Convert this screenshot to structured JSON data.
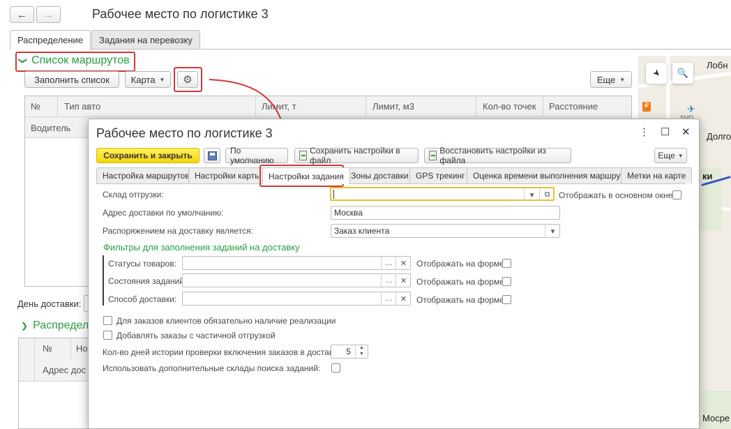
{
  "window": {
    "back_icon": "←",
    "forward_icon": "→",
    "title": "Рабочее место по логистике 3"
  },
  "main_tabs": [
    {
      "label": "Распределение",
      "active": true
    },
    {
      "label": "Задания на перевозку",
      "active": false
    }
  ],
  "routes": {
    "group_title": "Список маршрутов",
    "fill_button": "Заполнить список",
    "map_button": "Карта",
    "more_button": "Еще",
    "columns": [
      "№",
      "Тип авто",
      "Лимит, т",
      "Лимит, м3",
      "Кол-во точек",
      "Расстояние"
    ],
    "subheader": "Водитель"
  },
  "delivery_day_label": "День доставки:",
  "distribution": {
    "group_title": "Распредел",
    "columns": [
      "№",
      "Но"
    ],
    "subheader": "Адрес дос"
  },
  "map": {
    "labels": [
      "Лобн",
      "Долго",
      "ки",
      "Мосре"
    ],
    "svo_label": "SVO"
  },
  "dialog": {
    "title": "Рабочее место по логистике 3",
    "controls": [
      "⋮",
      "☐",
      "✕"
    ],
    "toolbar": {
      "save_close": "Сохранить и закрыть",
      "defaults": "По умолчанию",
      "save_file": "Сохранить настройки в файл",
      "restore_file": "Восстановить настройки из файла",
      "more": "Еще"
    },
    "tabs": [
      {
        "label": "Настройка маршрутов",
        "active": false
      },
      {
        "label": "Настройки карты",
        "active": false
      },
      {
        "label": "Настройки задания",
        "active": true
      },
      {
        "label": "Зоны доставки",
        "active": false
      },
      {
        "label": "GPS трекинг",
        "active": false
      },
      {
        "label": "Оценка времени выполнения маршрута",
        "active": false
      },
      {
        "label": "Метки на карте",
        "active": false
      }
    ],
    "form": {
      "warehouse_label": "Склад отгрузки:",
      "warehouse_value": "",
      "show_main_label": "Отображать  в основном окне:",
      "address_label": "Адрес доставки по умолчанию:",
      "address_value": "Москва",
      "order_label": "Распоряжением на доставку является:",
      "order_value": "Заказ клиента",
      "filters_title": "Фильтры для заполнения заданий на доставку",
      "filters": [
        {
          "label": "Статусы товаров:",
          "value": "",
          "show_label": "Отображать на форме:"
        },
        {
          "label": "Состояния заданий:",
          "value": "",
          "show_label": "Отображать на форме:"
        },
        {
          "label": "Способ доставки:",
          "value": "",
          "show_label": "Отображать на форме:"
        }
      ],
      "check_realization": "Для заказов клиентов обязательно наличие реализации",
      "check_partial": "Добавлять заказы с частичной отгрузкой",
      "history_days_label": "Кол-во дней истории проверки включения заказов в доставку :",
      "history_days_value": "5",
      "extra_warehouses_label": "Использовать дополнительные склады поиска заданий:"
    }
  }
}
